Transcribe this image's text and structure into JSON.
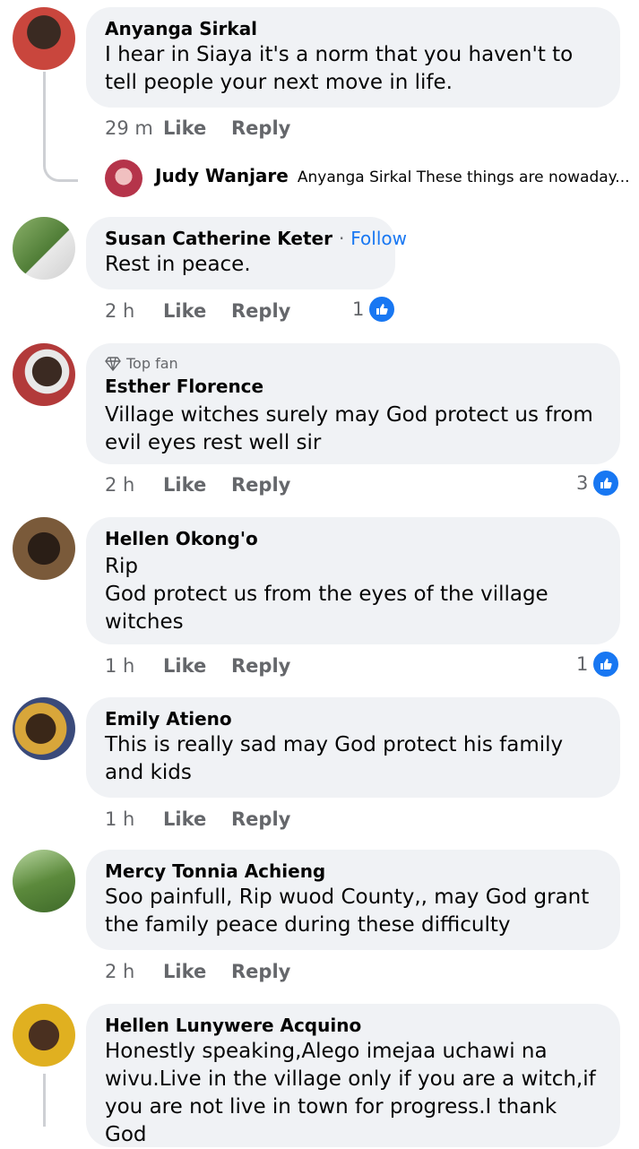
{
  "comments": [
    {
      "author": "Anyanga Sirkal",
      "text": "I hear in Siaya it's a norm that you haven't to tell people your next move in life.",
      "time": "29 m",
      "like_label": "Like",
      "reply_label": "Reply",
      "avatar_colors": [
        "#c9463d",
        "#2b2b2b"
      ]
    },
    {
      "author": "Susan Catherine Keter",
      "follow_label": "Follow",
      "text": "Rest in peace.",
      "time": "2 h",
      "like_label": "Like",
      "reply_label": "Reply",
      "reactions": "1",
      "avatar_colors": [
        "#6a9a4a",
        "#e3e3e3"
      ]
    },
    {
      "badge": "Top fan",
      "author": "Esther Florence",
      "text": "Village witches surely may God protect us from evil eyes rest well sir",
      "time": "2 h",
      "like_label": "Like",
      "reply_label": "Reply",
      "reactions": "3",
      "avatar_colors": [
        "#b23a3a",
        "#3b2a22"
      ]
    },
    {
      "author": "Hellen Okong'o",
      "text": "Rip\nGod protect us from the eyes of the village witches",
      "time": "1 h",
      "like_label": "Like",
      "reply_label": "Reply",
      "reactions": "1",
      "avatar_colors": [
        "#7a5a3a",
        "#2a1e16"
      ]
    },
    {
      "author": "Emily Atieno",
      "text": "This is really sad may God protect his family and kids",
      "time": "1 h",
      "like_label": "Like",
      "reply_label": "Reply",
      "avatar_colors": [
        "#d8a63a",
        "#3a2718"
      ]
    },
    {
      "author": "Mercy Tonnia Achieng",
      "text": "Soo painfull, Rip wuod County,, may God grant the family peace during these difficulty",
      "time": "2 h",
      "like_label": "Like",
      "reply_label": "Reply",
      "avatar_colors": [
        "#5c8a3c",
        "#b8d6a0"
      ]
    },
    {
      "author": "Hellen Lunywere Acquino",
      "text": "Honestly speaking,Alego imejaa uchawi na wivu.Live in the village only if you are a witch,if you are not live in town for progress.I thank God",
      "avatar_colors": [
        "#e0b020",
        "#4a3020"
      ]
    }
  ],
  "reply_preview": {
    "author": "Judy Wanjare",
    "text": "Anyanga Sirkal These things are nowaday..."
  },
  "colors": {
    "bubble": "#f0f2f5",
    "meta_text": "#65676b",
    "accent": "#1877f2",
    "thread_line": "#ced0d4"
  }
}
